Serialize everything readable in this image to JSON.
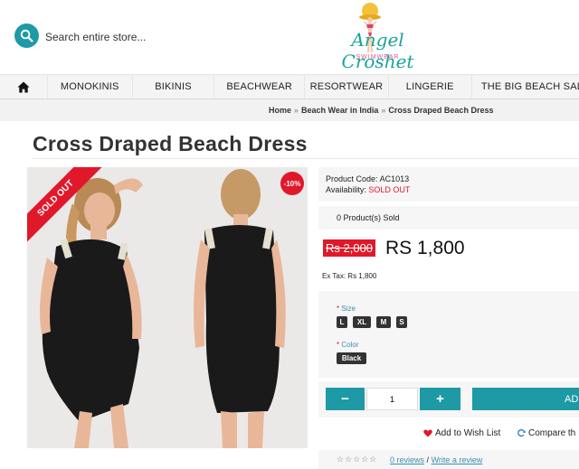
{
  "header": {
    "search_placeholder": "Search entire store...",
    "logo_text": "Angel Croshet",
    "logo_subtitle": "SWIMWEAR",
    "accent_color": "#1d9aa6"
  },
  "nav": {
    "home_icon": "home-icon",
    "items": [
      {
        "label": "MONOKINIS"
      },
      {
        "label": "BIKINIS"
      },
      {
        "label": "BEACHWEAR"
      },
      {
        "label": "RESORTWEAR"
      },
      {
        "label": "LINGERIE"
      },
      {
        "label": "THE BIG BEACH SAL"
      }
    ]
  },
  "breadcrumb": {
    "items": [
      "Home",
      "Beach Wear in India",
      "Cross Draped Beach Dress"
    ],
    "separator": "»"
  },
  "product": {
    "title": "Cross Draped Beach Dress",
    "sold_out_ribbon": "SOLD OUT",
    "discount_badge": "-10%",
    "code_label": "Product Code:",
    "code_value": "AC1013",
    "availability_label": "Availability:",
    "availability_value": "SOLD OUT",
    "sold_count": "0 Product(s) Sold",
    "old_price": "Rs 2,000",
    "new_price": "RS 1,800",
    "ex_tax": "Ex Tax: Rs 1,800",
    "size_label": "Size",
    "sizes": [
      "L",
      "XL",
      "M",
      "S"
    ],
    "color_label": "Color",
    "colors": [
      "Black"
    ],
    "quantity": "1",
    "minus_label": "−",
    "plus_label": "+",
    "add_label": "AD",
    "wishlist_label": "Add to Wish List",
    "compare_label": "Compare th",
    "reviews_label": "0 reviews",
    "write_review_label": "Write a review",
    "review_separator": "/"
  }
}
